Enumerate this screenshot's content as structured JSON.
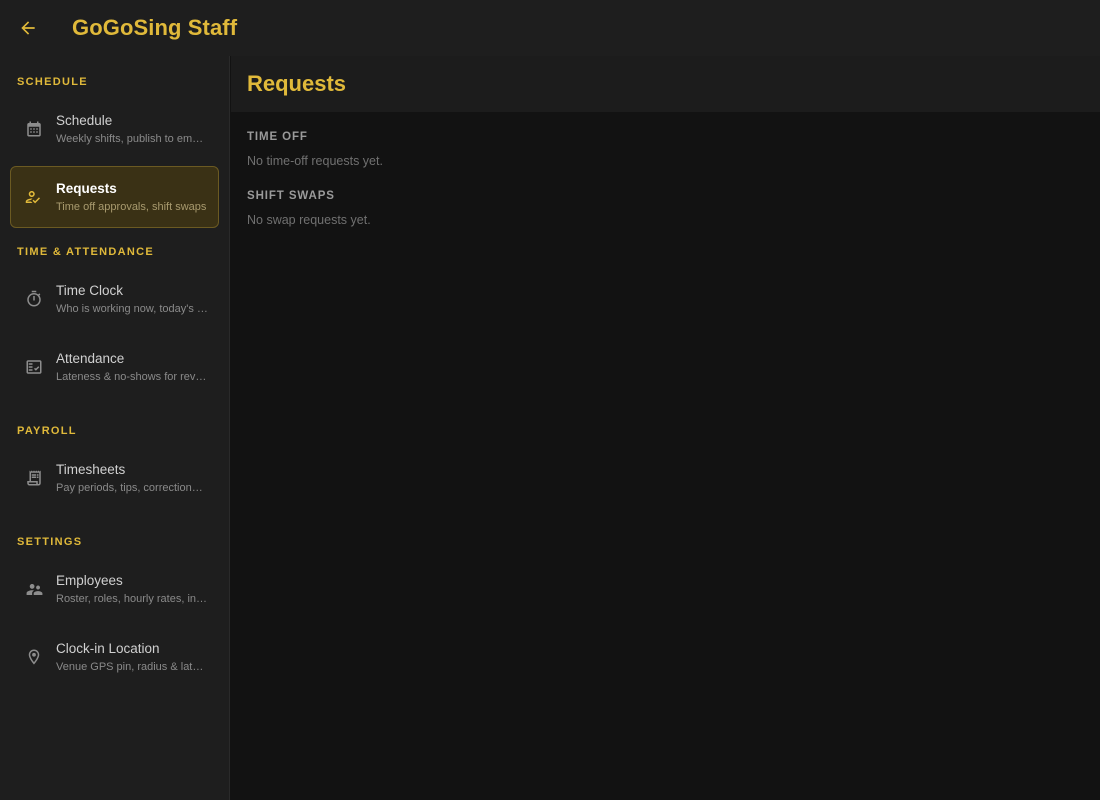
{
  "app": {
    "title": "GoGoSing Staff",
    "accent": "#e0b93a"
  },
  "sidebar": {
    "sections": [
      {
        "header": "SCHEDULE",
        "items": [
          {
            "title": "Schedule",
            "subtitle": "Weekly shifts, publish to employees",
            "icon": "calendar-icon",
            "active": false
          },
          {
            "title": "Requests",
            "subtitle": "Time off approvals, shift swaps",
            "icon": "person-check-icon",
            "active": true
          }
        ]
      },
      {
        "header": "TIME & ATTENDANCE",
        "items": [
          {
            "title": "Time Clock",
            "subtitle": "Who is working now, today's punches",
            "icon": "stopwatch-icon",
            "active": false
          },
          {
            "title": "Attendance",
            "subtitle": "Lateness & no-shows for review",
            "icon": "fact-check-icon",
            "active": false
          }
        ]
      },
      {
        "header": "PAYROLL",
        "items": [
          {
            "title": "Timesheets",
            "subtitle": "Pay periods, tips, corrections, export",
            "icon": "receipt-icon",
            "active": false
          }
        ]
      },
      {
        "header": "SETTINGS",
        "items": [
          {
            "title": "Employees",
            "subtitle": "Roster, roles, hourly rates, invites",
            "icon": "people-icon",
            "active": false
          },
          {
            "title": "Clock-in Location",
            "subtitle": "Venue GPS pin, radius & late grace",
            "icon": "location-pin-icon",
            "active": false
          }
        ]
      }
    ]
  },
  "main": {
    "title": "Requests",
    "time_off": {
      "header": "TIME OFF",
      "empty": "No time-off requests yet."
    },
    "shift_swaps": {
      "header": "SHIFT SWAPS",
      "empty": "No swap requests yet."
    }
  }
}
